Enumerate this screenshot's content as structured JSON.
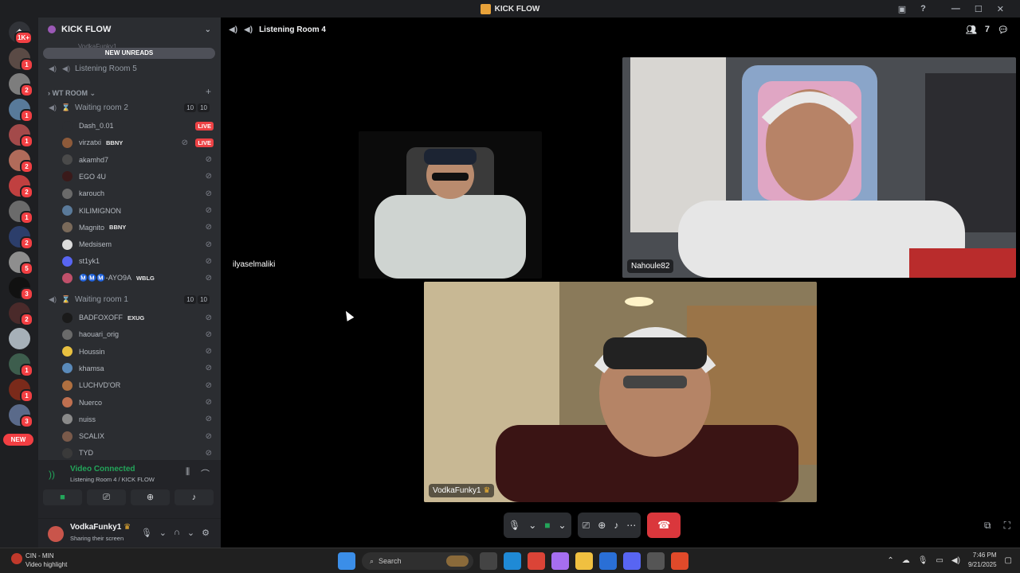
{
  "window": {
    "title": "KICK FLOW"
  },
  "rail": {
    "home_badge": "1K+",
    "new_label": "NEW",
    "servers": [
      {
        "badge": "1",
        "color": "#5a4a45"
      },
      {
        "badge": "2",
        "color": "#7d7d7d"
      },
      {
        "badge": "1",
        "color": "#587a9a"
      },
      {
        "badge": "1",
        "color": "#a34a4a"
      },
      {
        "badge": "2",
        "color": "#b06b5a"
      },
      {
        "badge": "2",
        "color": "#c04040"
      },
      {
        "badge": "1",
        "color": "#6b6b6b"
      },
      {
        "badge": "2",
        "color": "#2c3e6b"
      },
      {
        "badge": "5",
        "color": "#8e8e8e"
      },
      {
        "badge": "3",
        "color": "#111111"
      },
      {
        "badge": "2",
        "color": "#4a2a2a"
      },
      {
        "badge": "",
        "color": "#a6b0b8"
      },
      {
        "badge": "1",
        "color": "#3d5d4d"
      },
      {
        "badge": "1",
        "color": "#7a2a1a"
      },
      {
        "badge": "3",
        "color": "#5a6a8a"
      }
    ]
  },
  "sidebar": {
    "guild_name": "KICK FLOW",
    "new_unreads": "NEW UNREADS",
    "top_user": "VodkaFunky1",
    "channel_listening5": "Listening Room 5",
    "category": "WT ROOM",
    "waiting_room_2": {
      "name": "Waiting room 2",
      "count_a": "10",
      "count_b": "10",
      "users": [
        {
          "name": "Dash_0.01",
          "tag": "",
          "live": "LIVE",
          "color": "#2b2d31"
        },
        {
          "name": "virzatxi",
          "tag": "BBNY",
          "live": "LIVE",
          "color": "#8d5a3a"
        },
        {
          "name": "akamhd7",
          "tag": "",
          "live": "",
          "color": "#4a4a4a"
        },
        {
          "name": "EGO 4U",
          "tag": "",
          "live": "",
          "color": "#3a1a1a"
        },
        {
          "name": "karouch",
          "tag": "",
          "live": "",
          "color": "#6a6a6a"
        },
        {
          "name": "KILIMIGNON",
          "tag": "",
          "live": "",
          "color": "#5a7a9a"
        },
        {
          "name": "Magnito",
          "tag": "BBNY",
          "live": "",
          "color": "#7a6a5a"
        },
        {
          "name": "Medsisem",
          "tag": "",
          "live": "",
          "color": "#dcdcdc"
        },
        {
          "name": "st1yk1",
          "tag": "",
          "live": "",
          "color": "#5865f2"
        },
        {
          "name": "Ⓜ️Ⓜ️Ⓜ️-AYO9A",
          "tag": "WBLG",
          "live": "",
          "color": "#c0506a"
        }
      ]
    },
    "waiting_room_1": {
      "name": "Waiting room 1",
      "count_a": "10",
      "count_b": "10",
      "users": [
        {
          "name": "BADFOXOFF",
          "tag": "EXUG",
          "color": "#1a1a1a"
        },
        {
          "name": "haouari_orig",
          "tag": "",
          "color": "#6a6a6a"
        },
        {
          "name": "Houssin",
          "tag": "",
          "color": "#e8c040"
        },
        {
          "name": "khamsa",
          "tag": "",
          "color": "#5a8aba"
        },
        {
          "name": "LUCHVD'OR",
          "tag": "",
          "color": "#b07040"
        },
        {
          "name": "Nuerco",
          "tag": "",
          "color": "#c07050"
        },
        {
          "name": "nuiss",
          "tag": "",
          "color": "#8a8a8a"
        },
        {
          "name": "SCALIX",
          "tag": "",
          "color": "#7a5a4a"
        },
        {
          "name": "TYD",
          "tag": "",
          "color": "#3a3a3a"
        }
      ]
    },
    "voice": {
      "status": "Video Connected",
      "location": "Listening Room 4 / KICK FLOW"
    },
    "user": {
      "name": "VodkaFunky1",
      "status": "Sharing their screen"
    }
  },
  "stage": {
    "channel": "Listening Room 4",
    "member_count": "7",
    "participants": [
      {
        "name": "ilyaselmaliki"
      },
      {
        "name": "Nahoule82"
      },
      {
        "name": "VodkaFunky1"
      }
    ]
  },
  "taskbar": {
    "notif_title": "CIN - MIN",
    "notif_sub": "Video highlight",
    "search_placeholder": "Search",
    "time": "7:46 PM",
    "date": "9/21/2025"
  },
  "icons": {
    "mic": "mic-icon",
    "camera": "camera-icon",
    "screen": "screen-share-icon",
    "activity": "controller-icon",
    "soundboard": "soundboard-icon",
    "more": "more-icon",
    "hangup": "hangup-icon"
  },
  "colors": {
    "connected_green": "#23a55a",
    "live_red": "#ed4245",
    "hangup_red": "#da373c"
  }
}
